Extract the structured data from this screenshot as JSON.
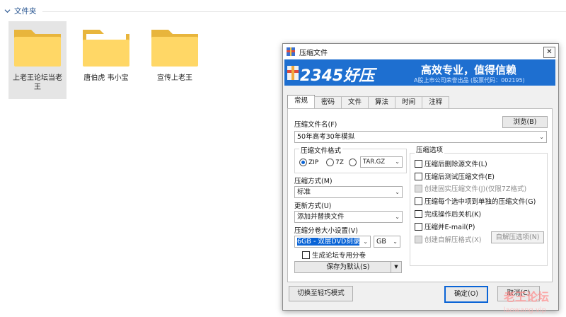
{
  "explorer": {
    "group_title": "文件夹",
    "folders": [
      {
        "label": "上老王论坛当老王",
        "selected": true
      },
      {
        "label": "唐伯虎 韦小宝",
        "selected": false
      },
      {
        "label": "宣传上老王",
        "selected": false
      }
    ]
  },
  "dialog": {
    "title": "压缩文件",
    "close_label": "✕",
    "banner": {
      "brand": "2345好压",
      "slogan": "高效专业，值得信赖",
      "subtext": "A股上市公司荣誉出品 (股票代码：002195)"
    },
    "tabs": [
      "常规",
      "密码",
      "文件",
      "算法",
      "时间",
      "注释"
    ],
    "active_tab": "常规",
    "archive_name_label": "压缩文件名(F)",
    "browse_button": "浏览(B)",
    "archive_name_value": "50年高考30年模拟",
    "format_group_label": "压缩文件格式",
    "formats": [
      {
        "label": "ZIP",
        "checked": true
      },
      {
        "label": "7Z",
        "checked": false
      },
      {
        "label": "TAR.GZ",
        "checked": false
      }
    ],
    "method_label": "压缩方式(M)",
    "method_value": "标准",
    "update_label": "更新方式(U)",
    "update_value": "添加并替换文件",
    "split_label": "压缩分卷大小设置(V)",
    "split_value": "6GB - 双层DVD刻录",
    "split_unit": "GB",
    "forum_split_label": "生成论坛专用分卷",
    "save_default_button": "保存为默认(S)",
    "options_group_label": "压缩选项",
    "options": [
      {
        "label": "压缩后删除源文件(L)",
        "disabled": false
      },
      {
        "label": "压缩后测试压缩文件(E)",
        "disabled": false
      },
      {
        "label": "创建固实压缩文件(J)(仅限7Z格式)",
        "disabled": true
      },
      {
        "label": "压缩每个选中项到单独的压缩文件(G)",
        "disabled": false
      },
      {
        "label": "完成操作后关机(K)",
        "disabled": false
      },
      {
        "label": "压缩并E-mail(P)",
        "disabled": false
      },
      {
        "label": "创建自解压格式(X)",
        "disabled": true
      }
    ],
    "sfx_options_button": "自解压选项(N)",
    "switch_mode_button": "切换至轻巧模式",
    "ok_button": "确定(O)",
    "cancel_button": "取消(C)"
  },
  "watermark": {
    "text": "老王论坛",
    "sub": "laowang.vip"
  },
  "colors": {
    "accent": "#0a64d6",
    "banner": "#1e6fd0"
  }
}
